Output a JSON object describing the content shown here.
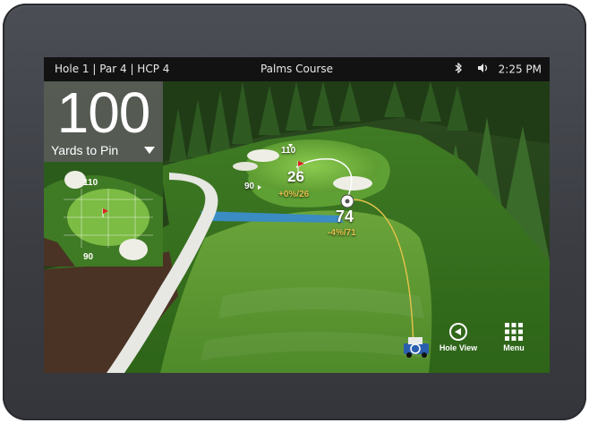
{
  "status_bar": {
    "hole_info": "Hole 1  |  Par 4  |  HCP 4",
    "course_name": "Palms Course",
    "clock": "2:25 PM",
    "icons": [
      "bluetooth-icon",
      "volume-icon"
    ]
  },
  "distance_panel": {
    "value": "100",
    "label": "Yards to Pin"
  },
  "minimap": {
    "top_yardage": "110",
    "bottom_yardage": "90"
  },
  "course_view": {
    "marker_110": "110",
    "marker_90": "90",
    "pin_distance": "26",
    "pin_adjust": "+0%/26",
    "target_distance": "74",
    "target_adjust": "-4%/71"
  },
  "buttons": {
    "hole_view_label": "Hole View",
    "menu_label": "Menu"
  },
  "colors": {
    "accent_yellow": "#e0c14a",
    "top_bar": "#121212",
    "bezel": "#3c3e44"
  }
}
